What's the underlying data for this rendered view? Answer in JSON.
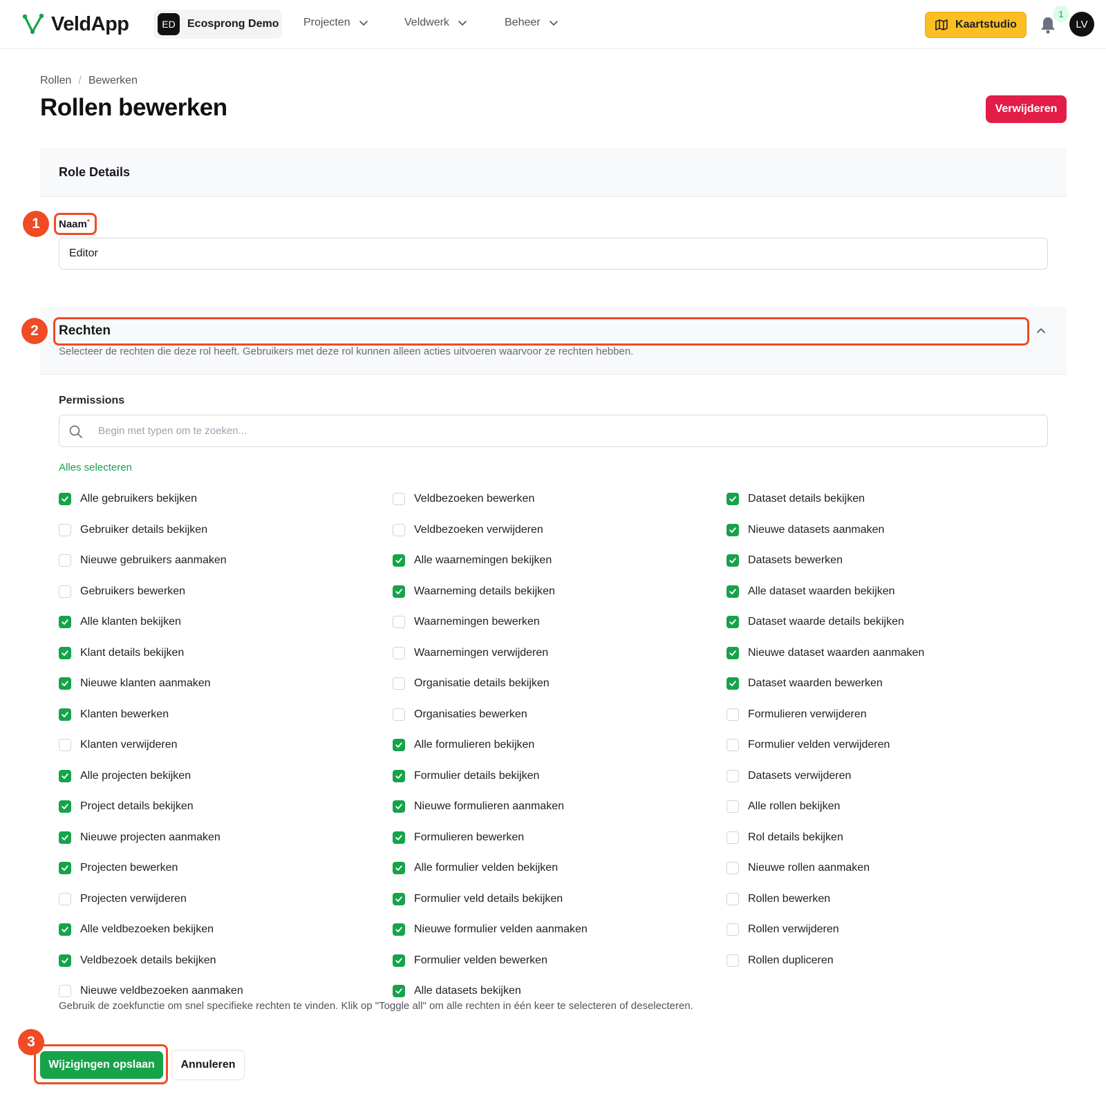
{
  "app": {
    "name": "VeldApp"
  },
  "tenant": {
    "initials": "ED",
    "name": "Ecosprong Demo"
  },
  "nav": [
    {
      "label": "Projecten"
    },
    {
      "label": "Veldwerk"
    },
    {
      "label": "Beheer"
    }
  ],
  "topbar": {
    "map_button": "Kaartstudio",
    "notification_count": "1",
    "user_initials": "LV"
  },
  "breadcrumb": {
    "root": "Rollen",
    "sep": "/",
    "current": "Bewerken"
  },
  "page": {
    "title": "Rollen bewerken",
    "delete_label": "Verwijderen"
  },
  "role_details": {
    "title": "Role Details",
    "name_label": "Naam",
    "name_required": "*",
    "name_value": "Editor"
  },
  "rechten": {
    "title": "Rechten",
    "description": "Selecteer de rechten die deze rol heeft. Gebruikers met deze rol kunnen alleen acties uitvoeren waarvoor ze rechten hebben.",
    "permissions_label": "Permissions",
    "search_placeholder": "Begin met typen om te zoeken...",
    "select_all": "Alles selecteren",
    "columns": [
      [
        {
          "label": "Alle gebruikers bekijken",
          "checked": true
        },
        {
          "label": "Gebruiker details bekijken",
          "checked": false
        },
        {
          "label": "Nieuwe gebruikers aanmaken",
          "checked": false
        },
        {
          "label": "Gebruikers bewerken",
          "checked": false
        },
        {
          "label": "Alle klanten bekijken",
          "checked": true
        },
        {
          "label": "Klant details bekijken",
          "checked": true
        },
        {
          "label": "Nieuwe klanten aanmaken",
          "checked": true
        },
        {
          "label": "Klanten bewerken",
          "checked": true
        },
        {
          "label": "Klanten verwijderen",
          "checked": false
        },
        {
          "label": "Alle projecten bekijken",
          "checked": true
        },
        {
          "label": "Project details bekijken",
          "checked": true
        },
        {
          "label": "Nieuwe projecten aanmaken",
          "checked": true
        },
        {
          "label": "Projecten bewerken",
          "checked": true
        },
        {
          "label": "Projecten verwijderen",
          "checked": false
        },
        {
          "label": "Alle veldbezoeken bekijken",
          "checked": true
        },
        {
          "label": "Veldbezoek details bekijken",
          "checked": true
        },
        {
          "label": "Nieuwe veldbezoeken aanmaken",
          "checked": false
        }
      ],
      [
        {
          "label": "Veldbezoeken bewerken",
          "checked": false
        },
        {
          "label": "Veldbezoeken verwijderen",
          "checked": false
        },
        {
          "label": "Alle waarnemingen bekijken",
          "checked": true
        },
        {
          "label": "Waarneming details bekijken",
          "checked": true
        },
        {
          "label": "Waarnemingen bewerken",
          "checked": false
        },
        {
          "label": "Waarnemingen verwijderen",
          "checked": false
        },
        {
          "label": "Organisatie details bekijken",
          "checked": false
        },
        {
          "label": "Organisaties bewerken",
          "checked": false
        },
        {
          "label": "Alle formulieren bekijken",
          "checked": true
        },
        {
          "label": "Formulier details bekijken",
          "checked": true
        },
        {
          "label": "Nieuwe formulieren aanmaken",
          "checked": true
        },
        {
          "label": "Formulieren bewerken",
          "checked": true
        },
        {
          "label": "Alle formulier velden bekijken",
          "checked": true
        },
        {
          "label": "Formulier veld details bekijken",
          "checked": true
        },
        {
          "label": "Nieuwe formulier velden aanmaken",
          "checked": true
        },
        {
          "label": "Formulier velden bewerken",
          "checked": true
        },
        {
          "label": "Alle datasets bekijken",
          "checked": true
        }
      ],
      [
        {
          "label": "Dataset details bekijken",
          "checked": true
        },
        {
          "label": "Nieuwe datasets aanmaken",
          "checked": true
        },
        {
          "label": "Datasets bewerken",
          "checked": true
        },
        {
          "label": "Alle dataset waarden bekijken",
          "checked": true
        },
        {
          "label": "Dataset waarde details bekijken",
          "checked": true
        },
        {
          "label": "Nieuwe dataset waarden aanmaken",
          "checked": true
        },
        {
          "label": "Dataset waarden bewerken",
          "checked": true
        },
        {
          "label": "Formulieren verwijderen",
          "checked": false
        },
        {
          "label": "Formulier velden verwijderen",
          "checked": false
        },
        {
          "label": "Datasets verwijderen",
          "checked": false
        },
        {
          "label": "Alle rollen bekijken",
          "checked": false
        },
        {
          "label": "Rol details bekijken",
          "checked": false
        },
        {
          "label": "Nieuwe rollen aanmaken",
          "checked": false
        },
        {
          "label": "Rollen bewerken",
          "checked": false
        },
        {
          "label": "Rollen verwijderen",
          "checked": false
        },
        {
          "label": "Rollen dupliceren",
          "checked": false
        }
      ]
    ],
    "help_text": "Gebruik de zoekfunctie om snel specifieke rechten te vinden. Klik op \"Toggle all\" om alle rechten in één keer te selecteren of deselecteren."
  },
  "actions": {
    "save_label": "Wijzigingen opslaan",
    "cancel_label": "Annuleren"
  },
  "annotations": {
    "step1": "1",
    "step2": "2",
    "step3": "3"
  },
  "colors": {
    "brand_green": "#16a34a",
    "danger": "#e11d48",
    "map_button": "#fbbf24",
    "annotation": "#ef4b25"
  }
}
